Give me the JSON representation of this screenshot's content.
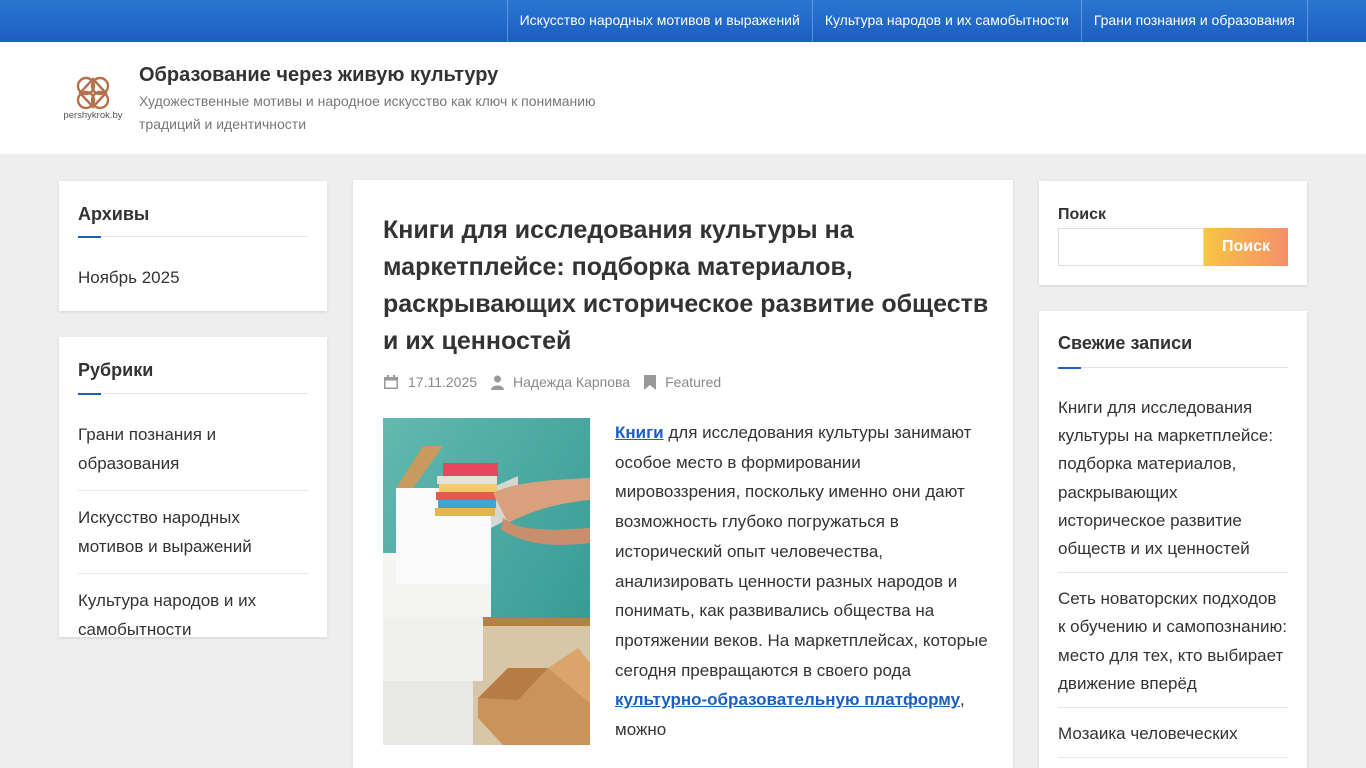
{
  "topnav": {
    "items": [
      {
        "label": "Искусство народных мотивов и выражений"
      },
      {
        "label": "Культура народов и их самобытности"
      },
      {
        "label": "Грани познания и образования"
      }
    ]
  },
  "header": {
    "logo_text": "pershykrok.by",
    "title": "Образование через живую культуру",
    "description": "Художественные мотивы и народное искусство как ключ к пониманию традиций и идентичности"
  },
  "archives": {
    "title": "Архивы",
    "items": [
      "Ноябрь 2025"
    ]
  },
  "categories": {
    "title": "Рубрики",
    "items": [
      "Грани познания и образования",
      "Искусство народных мотивов и выражений",
      "Культура народов и их самобытности"
    ]
  },
  "article": {
    "title": "Книги для исследования культуры на маркетплейсе: подборка материалов, раскрывающих историческое развитие обществ и их ценностей",
    "date": "17.11.2025",
    "author": "Надежда Карпова",
    "category": "Featured",
    "link1": "Книги",
    "text1": " для исследования культуры занимают особое место в формировании мировоззрения, поскольку именно они дают возможность глубоко погружаться в исторический опыт человечества, анализировать ценности разных народов и понимать, как развивались общества на протяжении веков. На маркетплейсах, которые сегодня превращаются в своего рода ",
    "link2": "культурно-образовательную платформу",
    "text2": ", можно"
  },
  "search": {
    "label": "Поиск",
    "placeholder": "",
    "button_label": "Поиск"
  },
  "recent": {
    "title": "Свежие записи",
    "items": [
      "Книги для исследования культуры на маркетплейсе: подборка материалов, раскрывающих историческое развитие обществ и их ценностей",
      "Сеть новаторских подходов к обучению и самопознанию: место для тех, кто выбирает движение вперёд",
      "Мозаика человеческих"
    ]
  },
  "colors": {
    "accent": "#1b5fc0",
    "search_button_gradient": [
      "#f7c544",
      "#f58f6a"
    ],
    "background": "#eeeeee"
  },
  "icons": [
    "logo-knot-icon",
    "calendar-icon",
    "user-icon",
    "bookmark-icon"
  ]
}
